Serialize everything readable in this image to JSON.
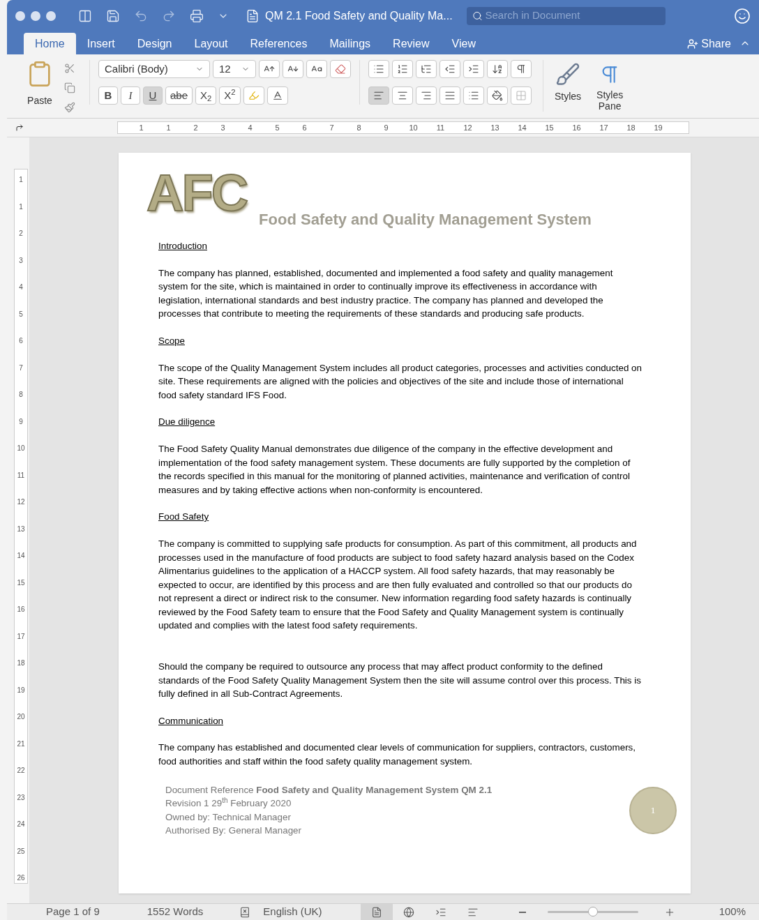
{
  "window": {
    "title": "QM 2.1 Food Safety and Quality Ma...",
    "search": {
      "placeholder": "Search in Document"
    }
  },
  "tabs": [
    {
      "label": "Home",
      "selected": true
    },
    {
      "label": "Insert",
      "selected": false
    },
    {
      "label": "Design",
      "selected": false
    },
    {
      "label": "Layout",
      "selected": false
    },
    {
      "label": "References",
      "selected": false
    },
    {
      "label": "Mailings",
      "selected": false
    },
    {
      "label": "Review",
      "selected": false
    },
    {
      "label": "View",
      "selected": false
    }
  ],
  "share": "Share",
  "ribbon": {
    "paste": "Paste",
    "font": "Calibri (Body)",
    "size": "12",
    "bold": "B",
    "italic": "I",
    "underline": "U",
    "underline_on": true,
    "strike": "abe",
    "subscript": "X$_{2}$",
    "superscript": "X$^{2}$",
    "align_left_on": true,
    "styles": "Styles",
    "styles_pane": "Styles Pane"
  },
  "ruler": {
    "numbers": [
      "1",
      "1",
      "2",
      "3",
      "4",
      "5",
      "6",
      "7",
      "8",
      "9",
      "10",
      "11",
      "12",
      "13",
      "14",
      "15",
      "16",
      "17",
      "18",
      "19"
    ],
    "vertical": [
      "1",
      "1",
      "2",
      "3",
      "4",
      "5",
      "6",
      "7",
      "8",
      "9",
      "10",
      "11",
      "12",
      "13",
      "14",
      "15",
      "16",
      "17",
      "18",
      "19",
      "20",
      "21",
      "22",
      "23",
      "24",
      "25",
      "26"
    ]
  },
  "document": {
    "logo": "AFC",
    "title": "Food Safety and Quality Management System",
    "sections": [
      {
        "heading": "Introduction",
        "paragraphs": [
          "The company has planned, established, documented and implemented a food safety and quality management system for the site, which is maintained in order to continually improve its effectiveness in accordance with legislation, international standards and best industry practice. The company has planned and developed the processes that contribute to meeting the requirements of these standards and producing safe products."
        ]
      },
      {
        "heading": "Scope",
        "paragraphs": [
          "The scope of the Quality Management System includes all product categories, processes and activities conducted on site. These requirements are aligned with the policies and objectives of the site and include those of international food safety standard IFS Food."
        ]
      },
      {
        "heading": "Due diligence",
        "paragraphs": [
          "The Food Safety Quality Manual demonstrates due diligence of the company in the effective development and implementation of the food safety management system. These documents are fully supported by the completion of the records specified in this manual for the monitoring of planned activities, maintenance and verification of control measures and by taking effective actions when non-conformity is encountered."
        ]
      },
      {
        "heading": "Food Safety",
        "paragraphs": [
          "The company is committed to supplying safe products for consumption.  As part of this commitment, all products and processes used in the manufacture of food products are subject to food safety hazard analysis based on the Codex Alimentarius guidelines to the application of a HACCP system. All food safety hazards, that may reasonably be expected to occur, are identified by this process and are then fully evaluated and controlled so that our products do not represent a direct or indirect risk to the consumer. New information regarding food safety hazards is continually reviewed by the Food Safety team to ensure that the Food Safety and Quality Management system is continually updated and complies with the latest food safety requirements.",
          "Should the company be required to outsource any process that may affect product conformity to the defined standards of the Food Safety Quality Management System then the site will assume control over this process. This is fully defined in all Sub-Contract Agreements."
        ]
      },
      {
        "heading": "Communication",
        "paragraphs": [
          "The company has established and documented clear levels of communication for suppliers, contractors, customers, food authorities and staff within the food safety quality management system."
        ]
      }
    ],
    "footer": [
      "Document Reference **Food Safety and Quality Management System QM 2.1**",
      "Revision 1   29$^{th}$ February 2020",
      "Owned by: Technical Manager",
      "Authorised By: General Manager"
    ],
    "page_badge": "1"
  },
  "status_bar": {
    "page": "Page 1 of 9",
    "words": "1552 Words",
    "language": "English (UK)",
    "views": [
      {
        "kind": "print",
        "selected": true
      },
      {
        "kind": "web",
        "selected": false
      },
      {
        "kind": "outline",
        "selected": false
      },
      {
        "kind": "draft",
        "selected": false
      }
    ],
    "zoom": {
      "level": 0.5,
      "reading": "100%"
    }
  }
}
